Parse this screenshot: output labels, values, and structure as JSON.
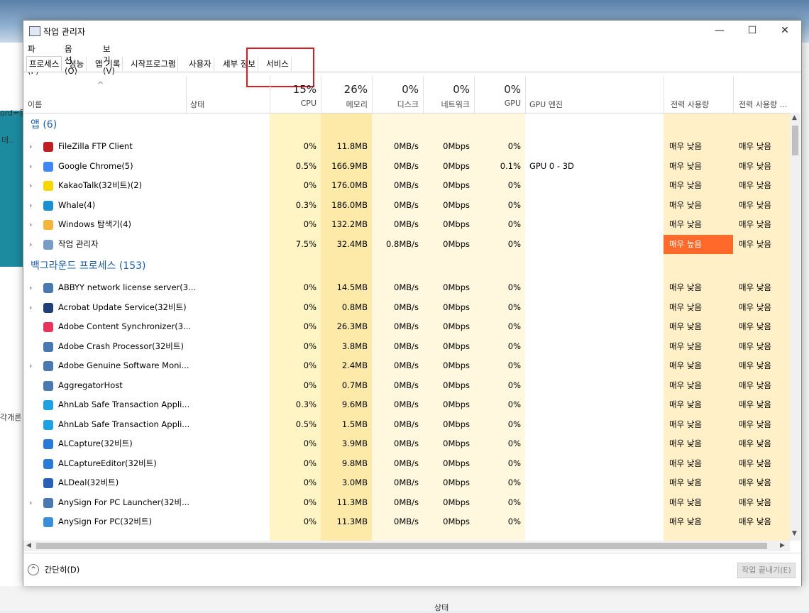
{
  "window": {
    "title": "작업 관리자",
    "minimize": "—",
    "maximize": "☐",
    "close": "✕"
  },
  "menu": [
    "파일(F)",
    "옵션(O)",
    "보기(V)"
  ],
  "tabs": [
    "프로세스",
    "성능",
    "앱 기록",
    "시작프로그램",
    "사용자",
    "세부 정보",
    "서비스"
  ],
  "columns": {
    "name": "이름",
    "status": "상태",
    "cpu": {
      "pct": "15%",
      "label": "CPU"
    },
    "memory": {
      "pct": "26%",
      "label": "메모리"
    },
    "disk": {
      "pct": "0%",
      "label": "디스크"
    },
    "network": {
      "pct": "0%",
      "label": "네트워크"
    },
    "gpu": {
      "pct": "0%",
      "label": "GPU"
    },
    "gpu_engine": "GPU 엔진",
    "power": "전력 사용량",
    "power_trend": "전력 사용량 ..."
  },
  "sections": {
    "apps": "앱 (6)",
    "background": "백그라운드 프로세스 (153)"
  },
  "apps": [
    {
      "name": "FileZilla FTP Client",
      "cpu": "0%",
      "mem": "11.8MB",
      "disk": "0MB/s",
      "net": "0Mbps",
      "gpu": "0%",
      "engine": "",
      "power": "매우 낮음",
      "trend": "매우 낮음",
      "expander": "›",
      "icon": "filezilla-icon",
      "color": "#bf1e24"
    },
    {
      "name": "Google Chrome(5)",
      "cpu": "0.5%",
      "mem": "166.9MB",
      "disk": "0MB/s",
      "net": "0Mbps",
      "gpu": "0.1%",
      "engine": "GPU 0 - 3D",
      "power": "매우 낮음",
      "trend": "매우 낮음",
      "expander": "›",
      "icon": "chrome-icon",
      "color": "#4285f4"
    },
    {
      "name": "KakaoTalk(32비트)(2)",
      "cpu": "0%",
      "mem": "176.0MB",
      "disk": "0MB/s",
      "net": "0Mbps",
      "gpu": "0%",
      "engine": "",
      "power": "매우 낮음",
      "trend": "매우 낮음",
      "expander": "›",
      "icon": "kakaotalk-icon",
      "color": "#f7d600"
    },
    {
      "name": "Whale(4)",
      "cpu": "0.3%",
      "mem": "186.0MB",
      "disk": "0MB/s",
      "net": "0Mbps",
      "gpu": "0%",
      "engine": "",
      "power": "매우 낮음",
      "trend": "매우 낮음",
      "expander": "›",
      "icon": "whale-icon",
      "color": "#1b8fd1"
    },
    {
      "name": "Windows 탐색기(4)",
      "cpu": "0%",
      "mem": "132.2MB",
      "disk": "0MB/s",
      "net": "0Mbps",
      "gpu": "0%",
      "engine": "",
      "power": "매우 낮음",
      "trend": "매우 낮음",
      "expander": "›",
      "icon": "explorer-icon",
      "color": "#f4b63a"
    },
    {
      "name": "작업 관리자",
      "cpu": "7.5%",
      "mem": "32.4MB",
      "disk": "0.8MB/s",
      "net": "0Mbps",
      "gpu": "0%",
      "engine": "",
      "power": "매우 높음",
      "trend": "매우 낮음",
      "expander": "›",
      "icon": "task-manager-icon",
      "color": "#7a9cc4"
    }
  ],
  "background": [
    {
      "name": "ABBYY network license server(3...",
      "cpu": "0%",
      "mem": "14.5MB",
      "disk": "0MB/s",
      "net": "0Mbps",
      "gpu": "0%",
      "power": "매우 낮음",
      "trend": "매우 낮음",
      "expander": "›",
      "icon": "service-icon",
      "color": "#4a78b0"
    },
    {
      "name": "Acrobat Update Service(32비트)",
      "cpu": "0%",
      "mem": "0.8MB",
      "disk": "0MB/s",
      "net": "0Mbps",
      "gpu": "0%",
      "power": "매우 낮음",
      "trend": "매우 낮음",
      "expander": "›",
      "icon": "window-icon",
      "color": "#1f3f78"
    },
    {
      "name": "Adobe Content Synchronizer(3...",
      "cpu": "0%",
      "mem": "26.3MB",
      "disk": "0MB/s",
      "net": "0Mbps",
      "gpu": "0%",
      "power": "매우 낮음",
      "trend": "매우 낮음",
      "expander": "",
      "icon": "adobe-cc-icon",
      "color": "#e8345a"
    },
    {
      "name": "Adobe Crash Processor(32비트)",
      "cpu": "0%",
      "mem": "3.8MB",
      "disk": "0MB/s",
      "net": "0Mbps",
      "gpu": "0%",
      "power": "매우 낮음",
      "trend": "매우 낮음",
      "expander": "",
      "icon": "service-icon",
      "color": "#4a78b0"
    },
    {
      "name": "Adobe Genuine Software Moni...",
      "cpu": "0%",
      "mem": "2.4MB",
      "disk": "0MB/s",
      "net": "0Mbps",
      "gpu": "0%",
      "power": "매우 낮음",
      "trend": "매우 낮음",
      "expander": "›",
      "icon": "service-icon",
      "color": "#4a78b0"
    },
    {
      "name": "AggregatorHost",
      "cpu": "0%",
      "mem": "0.7MB",
      "disk": "0MB/s",
      "net": "0Mbps",
      "gpu": "0%",
      "power": "매우 낮음",
      "trend": "매우 낮음",
      "expander": "",
      "icon": "service-icon",
      "color": "#4a78b0"
    },
    {
      "name": "AhnLab Safe Transaction Appli...",
      "cpu": "0.3%",
      "mem": "9.6MB",
      "disk": "0MB/s",
      "net": "0Mbps",
      "gpu": "0%",
      "power": "매우 낮음",
      "trend": "매우 낮음",
      "expander": "",
      "icon": "ahnlab-icon",
      "color": "#1da1e2"
    },
    {
      "name": "AhnLab Safe Transaction Appli...",
      "cpu": "0.5%",
      "mem": "1.5MB",
      "disk": "0MB/s",
      "net": "0Mbps",
      "gpu": "0%",
      "power": "매우 낮음",
      "trend": "매우 낮음",
      "expander": "",
      "icon": "ahnlab-icon",
      "color": "#1da1e2"
    },
    {
      "name": "ALCapture(32비트)",
      "cpu": "0%",
      "mem": "3.9MB",
      "disk": "0MB/s",
      "net": "0Mbps",
      "gpu": "0%",
      "power": "매우 낮음",
      "trend": "매우 낮음",
      "expander": "",
      "icon": "alcapture-icon",
      "color": "#2a7bd8"
    },
    {
      "name": "ALCaptureEditor(32비트)",
      "cpu": "0%",
      "mem": "9.8MB",
      "disk": "0MB/s",
      "net": "0Mbps",
      "gpu": "0%",
      "power": "매우 낮음",
      "trend": "매우 낮음",
      "expander": "",
      "icon": "alcapture-icon",
      "color": "#2a7bd8"
    },
    {
      "name": "ALDeal(32비트)",
      "cpu": "0%",
      "mem": "3.0MB",
      "disk": "0MB/s",
      "net": "0Mbps",
      "gpu": "0%",
      "power": "매우 낮음",
      "trend": "매우 낮음",
      "expander": "",
      "icon": "aldeal-icon",
      "color": "#2a5fb8"
    },
    {
      "name": "AnySign For PC Launcher(32비...",
      "cpu": "0%",
      "mem": "11.3MB",
      "disk": "0MB/s",
      "net": "0Mbps",
      "gpu": "0%",
      "power": "매우 낮음",
      "trend": "매우 낮음",
      "expander": "›",
      "icon": "service-icon",
      "color": "#4a78b0"
    },
    {
      "name": "AnySign For PC(32비트)",
      "cpu": "0%",
      "mem": "11.3MB",
      "disk": "0MB/s",
      "net": "0Mbps",
      "gpu": "0%",
      "power": "매우 낮음",
      "trend": "매우 낮음",
      "expander": "",
      "icon": "anysign-icon",
      "color": "#3a8fd8"
    }
  ],
  "footer": {
    "fewer_details": "간단히(D)",
    "end_task": "작업 끝내기(E)"
  },
  "colors": {
    "cpu_bg": "#fff4c4",
    "mem_bg": "#fde9a8",
    "light_bg": "#fff8de",
    "power_bg": "#fff0c8",
    "high_power": "#ff6a2a",
    "section": "#1f5fa8"
  },
  "background_fragments": [
    "ord=등",
    "데..",
    "각개론",
    "상태"
  ]
}
